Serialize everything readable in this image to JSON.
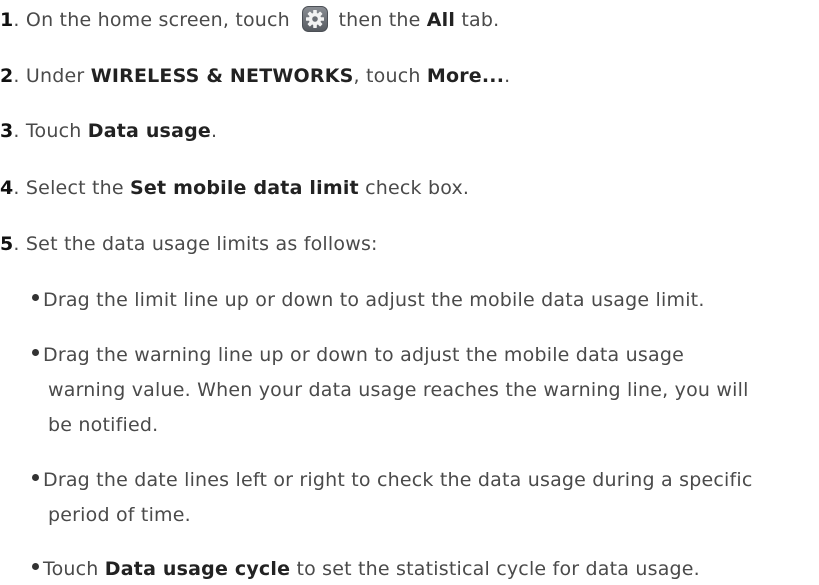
{
  "steps": [
    {
      "number": "1",
      "dot": ".",
      "t1": "On the home screen, touch",
      "t2": "then the",
      "b1": "All",
      "t3": "tab.",
      "icon": "settings-gear-icon"
    },
    {
      "number": "2",
      "dot": ".",
      "t1": "Under",
      "b1": "WIRELESS & NETWORKS",
      "t2": ", touch",
      "b2": "More...",
      "t3": "."
    },
    {
      "number": "3",
      "dot": ".",
      "t1": "Touch",
      "b1": "Data usage",
      "t2": "."
    },
    {
      "number": "4",
      "dot": ".",
      "t1": "Select the",
      "b1": "Set mobile data limit",
      "t2": "check box."
    },
    {
      "number": "5",
      "dot": ".",
      "t1": "Set the data usage limits as follows:"
    }
  ],
  "bullets": {
    "b1": "Drag the limit line up or down to adjust the mobile data usage limit.",
    "b2_l1": "Drag the warning line up or down to adjust the mobile data usage",
    "b2_l2": "warning value. When your data usage reaches the warning line, you will",
    "b2_l3": "be notified.",
    "b3_l1": "Drag the date lines left or right to check the data usage during a specific",
    "b3_l2": "period of time.",
    "b4_t1": "Touch",
    "b4_b1": "Data usage cycle",
    "b4_t2": "to set the statistical cycle for data usage."
  },
  "colors": {
    "text": "#4a4a4a",
    "number": "#111111",
    "icon_bg": "#6b6f75"
  }
}
